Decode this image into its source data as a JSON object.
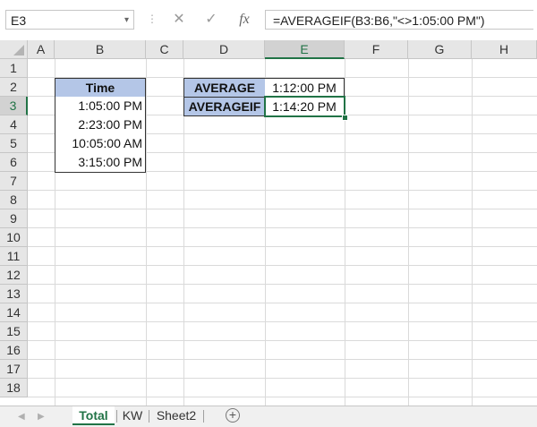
{
  "formula_bar": {
    "name_box": "E3",
    "cancel_icon": "✕",
    "confirm_icon": "✓",
    "fx_icon": "fx",
    "formula": "=AVERAGEIF(B3:B6,\"<>1:05:00 PM\")"
  },
  "columns": [
    "A",
    "B",
    "C",
    "D",
    "E",
    "F",
    "G",
    "H"
  ],
  "rows": [
    "1",
    "2",
    "3",
    "4",
    "5",
    "6",
    "7",
    "8",
    "9",
    "10",
    "11",
    "12",
    "13",
    "14",
    "15",
    "16",
    "17",
    "18"
  ],
  "table": {
    "header": "Time",
    "values": [
      "1:05:00 PM",
      "2:23:00 PM",
      "10:05:00 AM",
      "3:15:00 PM"
    ]
  },
  "results": {
    "average_label": "AVERAGE",
    "average_value": "1:12:00 PM",
    "averageif_label": "AVERAGEIF",
    "averageif_value": "1:14:20 PM"
  },
  "sheets": {
    "tab1": "Total",
    "tab2": "KW",
    "tab3": "Sheet2",
    "add": "+"
  },
  "colors": {
    "accent": "#217346",
    "header_fill": "#b4c6e7"
  }
}
